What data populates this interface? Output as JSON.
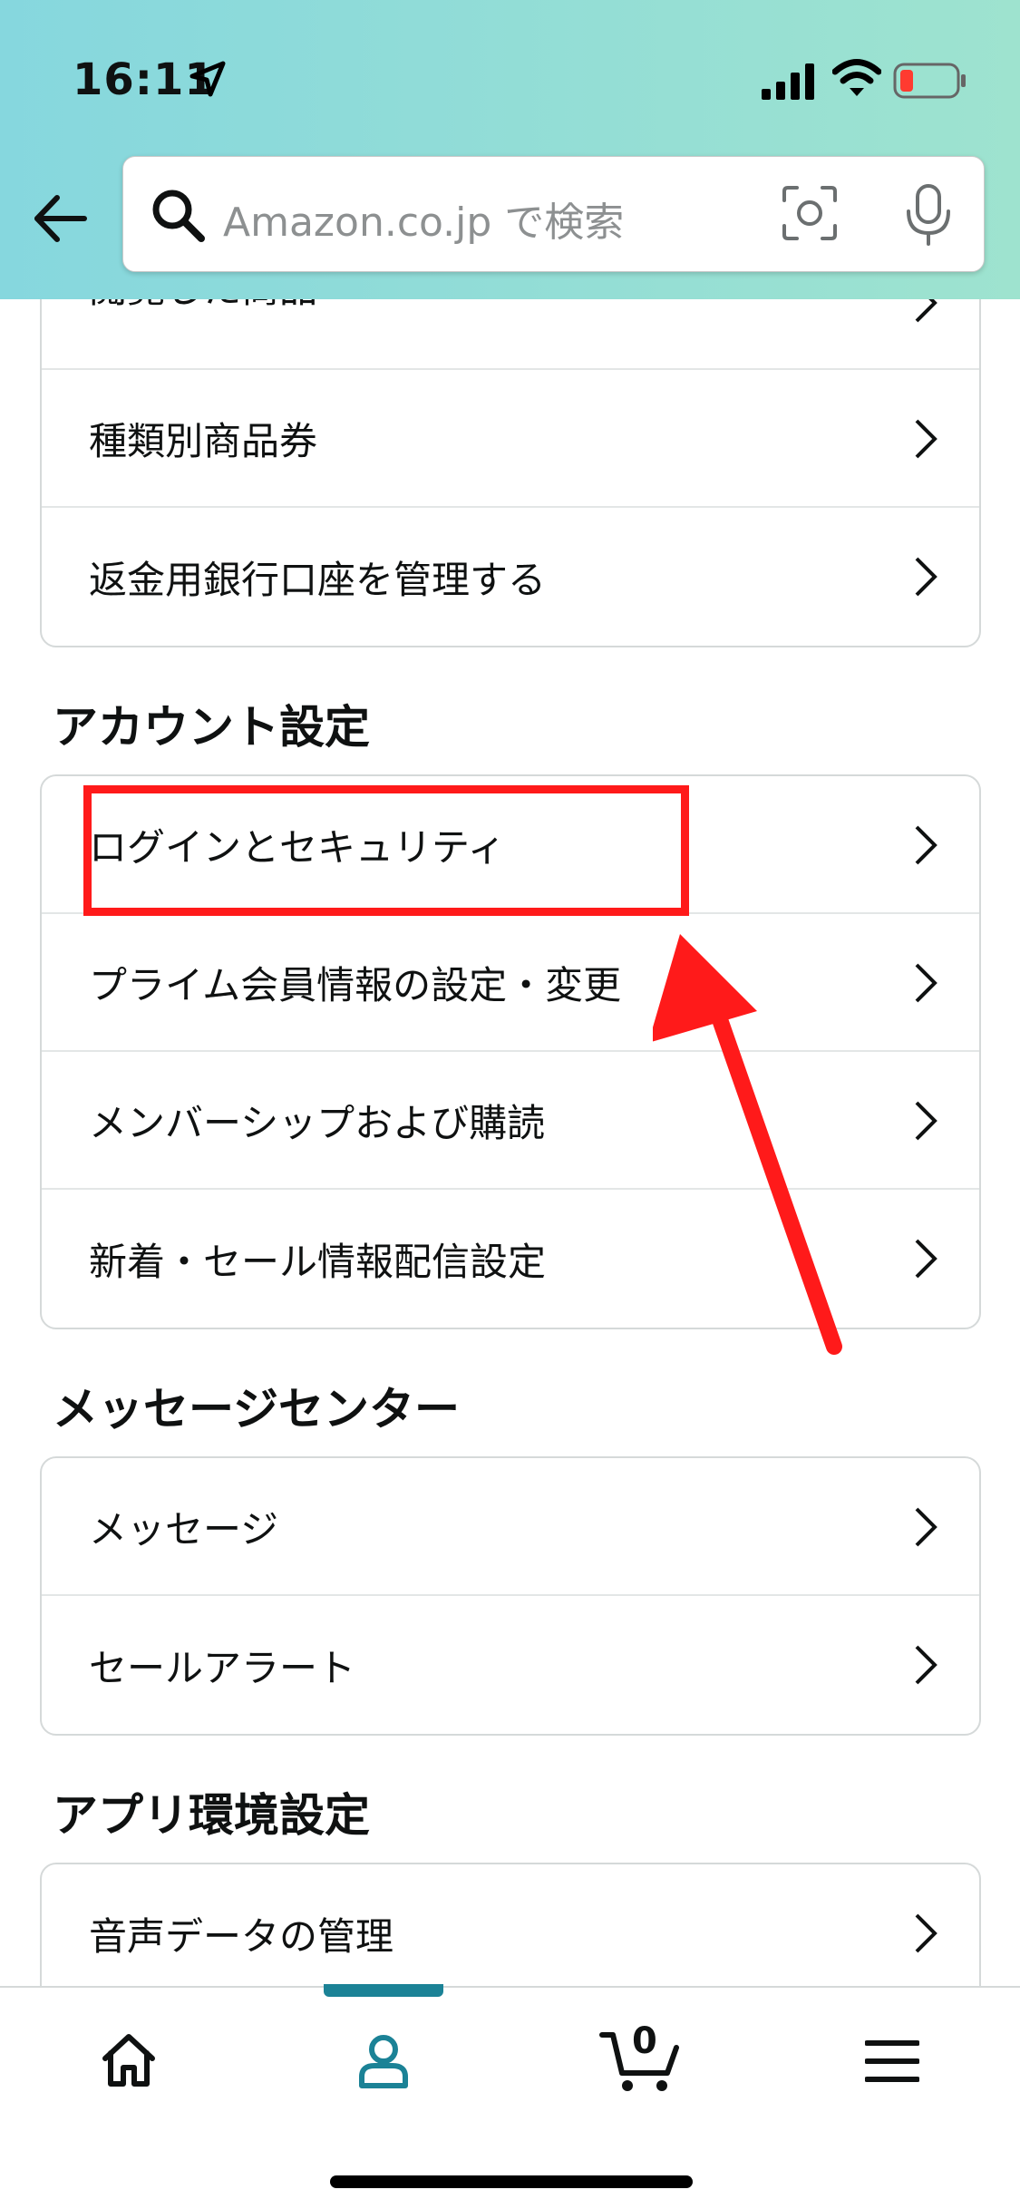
{
  "status_bar": {
    "time": "16:11"
  },
  "search": {
    "placeholder": "Amazon.co.jp で検索"
  },
  "top_card": {
    "items": [
      {
        "label": "閲覧した商品"
      },
      {
        "label": "種類別商品券"
      },
      {
        "label": "返金用銀行口座を管理する"
      }
    ]
  },
  "account_settings": {
    "title": "アカウント設定",
    "items": [
      {
        "label": "ログインとセキュリティ"
      },
      {
        "label": "プライム会員情報の設定・変更"
      },
      {
        "label": "メンバーシップおよび購読"
      },
      {
        "label": "新着・セール情報配信設定"
      }
    ]
  },
  "message_center": {
    "title": "メッセージセンター",
    "items": [
      {
        "label": "メッセージ"
      },
      {
        "label": "セールアラート"
      }
    ]
  },
  "app_settings": {
    "title": "アプリ環境設定",
    "items": [
      {
        "label": "音声データの管理"
      }
    ]
  },
  "bottom_nav": {
    "cart_count": "0",
    "active_tab": "account",
    "active_color": "#1b8296"
  },
  "annotation_color": "#ff1a1a"
}
